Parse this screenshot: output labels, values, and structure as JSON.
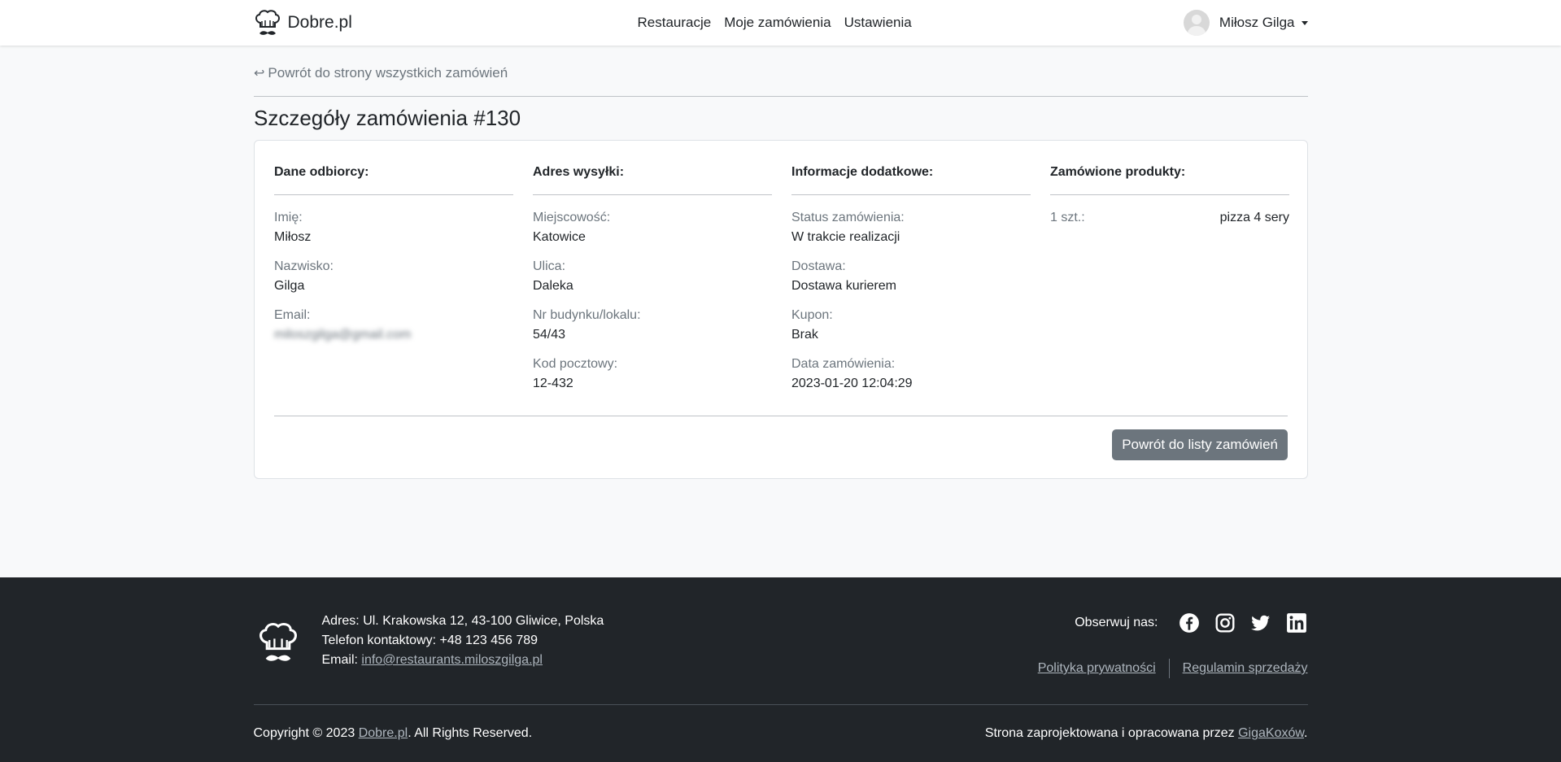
{
  "navbar": {
    "brand": "Dobre.pl",
    "links": [
      "Restauracje",
      "Moje zamówienia",
      "Ustawienia"
    ],
    "user_name": "Miłosz Gilga"
  },
  "main": {
    "back_link": "Powrót do strony wszystkich zamówień",
    "title": "Szczegóły zamówienia #130",
    "columns": [
      {
        "title": "Dane odbiorcy:",
        "fields": [
          {
            "label": "Imię:",
            "value": "Miłosz"
          },
          {
            "label": "Nazwisko:",
            "value": "Gilga"
          },
          {
            "label": "Email:",
            "value": "miloszgilga@gmail.com"
          }
        ]
      },
      {
        "title": "Adres wysyłki:",
        "fields": [
          {
            "label": "Miejscowość:",
            "value": "Katowice"
          },
          {
            "label": "Ulica:",
            "value": "Daleka"
          },
          {
            "label": "Nr budynku/lokalu:",
            "value": "54/43"
          },
          {
            "label": "Kod pocztowy:",
            "value": "12-432"
          }
        ]
      },
      {
        "title": "Informacje dodatkowe:",
        "fields": [
          {
            "label": "Status zamówienia:",
            "value": "W trakcie realizacji"
          },
          {
            "label": "Dostawa:",
            "value": "Dostawa kurierem"
          },
          {
            "label": "Kupon:",
            "value": "Brak"
          },
          {
            "label": "Data zamówienia:",
            "value": "2023-01-20 12:04:29"
          }
        ]
      },
      {
        "title": "Zamówione produkty:",
        "products": [
          {
            "qty": "1 szt.:",
            "name": "pizza 4 sery"
          }
        ]
      }
    ],
    "back_button": "Powrót do listy zamówień"
  },
  "footer": {
    "address": "Adres: Ul. Krakowska 12, 43-100 Gliwice, Polska",
    "phone": "Telefon kontaktowy: +48 123 456 789",
    "email_label": "Email: ",
    "email": "info@restaurants.miloszgilga.pl",
    "follow_label": "Obserwuj nas:",
    "social_icons": [
      "facebook-icon",
      "instagram-icon",
      "twitter-icon",
      "linkedin-icon"
    ],
    "privacy": "Polityka prywatności",
    "terms": "Regulamin sprzedaży",
    "copyright_prefix": "Copyright © 2023 ",
    "copyright_link": "Dobre.pl",
    "copyright_suffix": ". All Rights Reserved.",
    "credit_prefix": "Strona zaprojektowana i opracowana przez ",
    "credit_link": "GigaKoxów",
    "credit_suffix": "."
  },
  "colors": {
    "background": "#f8f9fa",
    "footer": "#212529",
    "button": "#6c757d",
    "muted": "#6c757d"
  }
}
